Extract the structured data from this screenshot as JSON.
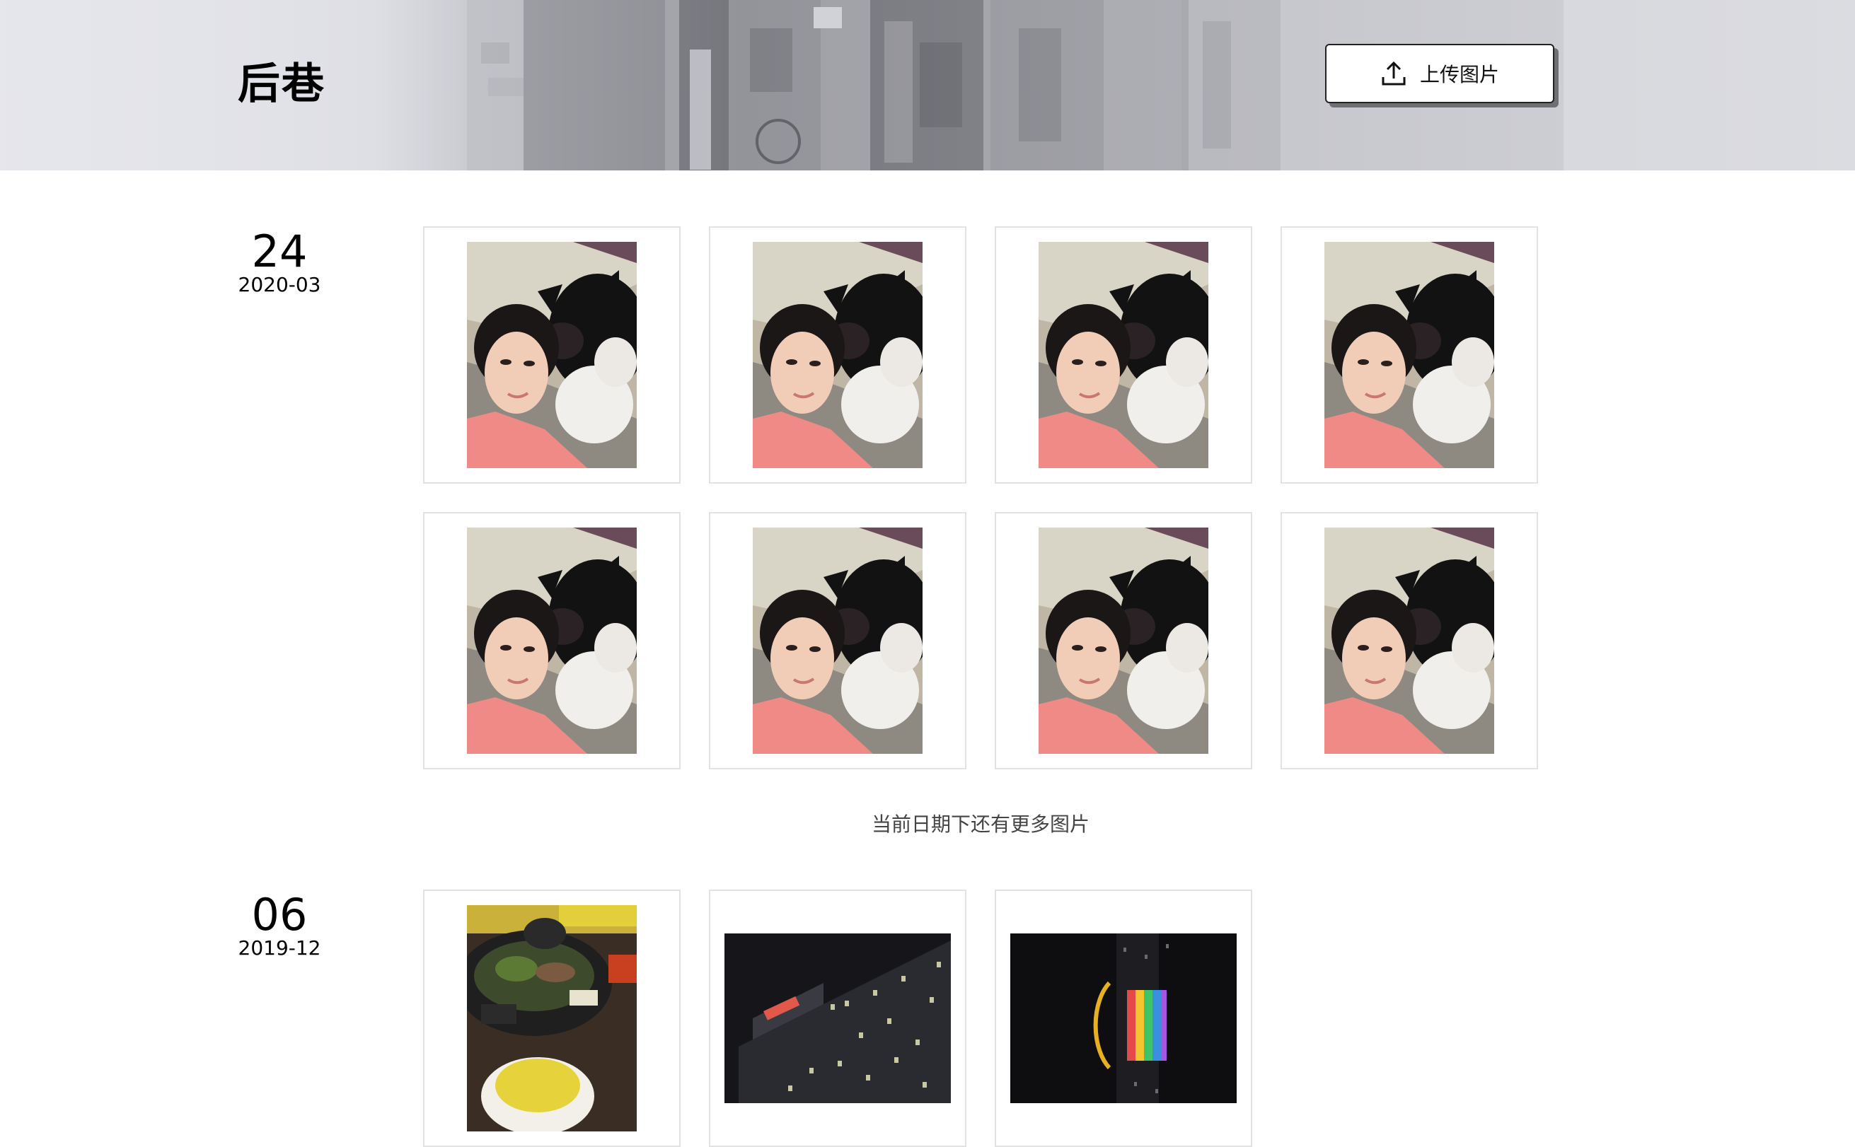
{
  "header": {
    "title": "后巷",
    "upload_label": "上传图片",
    "upload_icon": "upload-icon"
  },
  "groups": [
    {
      "day": "24",
      "year_month": "2020-03",
      "photos": [
        {
          "subject": "selfie-with-cat"
        },
        {
          "subject": "selfie-with-cat"
        },
        {
          "subject": "selfie-with-cat"
        },
        {
          "subject": "selfie-with-cat"
        },
        {
          "subject": "selfie-with-cat"
        },
        {
          "subject": "selfie-with-cat"
        },
        {
          "subject": "selfie-with-cat"
        },
        {
          "subject": "selfie-with-cat"
        }
      ],
      "more_note": "当前日期下还有更多图片"
    },
    {
      "day": "06",
      "year_month": "2019-12",
      "photos": [
        {
          "subject": "hotpot-meal"
        },
        {
          "subject": "building-at-night"
        },
        {
          "subject": "neon-ferris-wheel-night"
        }
      ]
    }
  ],
  "colors": {
    "card_border": "#e2e2e2",
    "button_shadow": "#6f7075",
    "shirt_pink": "#f08a86"
  }
}
